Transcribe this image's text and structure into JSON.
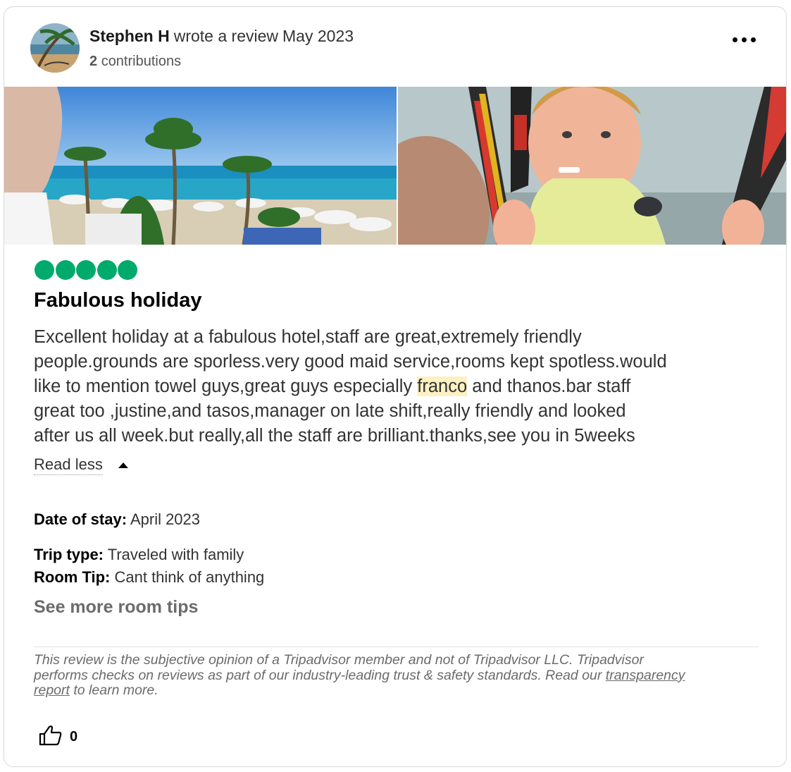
{
  "review": {
    "author": "Stephen H",
    "action": "wrote a review",
    "date": "May 2023",
    "contributions_count": "2",
    "contributions_label": "contributions",
    "rating": 5,
    "rating_color": "#00aa6c",
    "title": "Fabulous holiday",
    "body": {
      "line1": "Excellent holiday at a fabulous hotel,staff are great,extremely friendly",
      "line2": "people.grounds are sporless.very good maid service,rooms kept spotless.would",
      "line3_pre": "like to mention towel guys,great guys especially ",
      "line3_highlight": "franco",
      "line3_post": " and thanos.bar staff",
      "line4": "great too ,justine,and tasos,manager on late shift,really friendly and looked",
      "line5": "after us all week.but really,all the staff are brilliant.thanks,see you in 5weeks"
    },
    "read_less": "Read less",
    "date_of_stay_label": "Date of stay:",
    "date_of_stay": "April 2023",
    "trip_type_label": "Trip type:",
    "trip_type": "Traveled with family",
    "room_tip_label": "Room Tip:",
    "room_tip": "Cant think of anything",
    "see_more_room_tips": "See more room tips",
    "disclaimer": {
      "line1": "This review is the subjective opinion of a Tripadvisor member and not of Tripadvisor LLC. Tripadvisor",
      "line2_pre": "performs checks on reviews as part of our industry-leading trust & safety standards. Read our ",
      "link_part1": "transparency",
      "link_part2": "report",
      "line3_post": " to learn more."
    },
    "helpful_votes": "0"
  },
  "icons": {
    "more": "more-options-icon",
    "caret": "caret-up-icon",
    "helpful": "thumbs-up-icon",
    "rating": "rating-bubble-icon"
  }
}
